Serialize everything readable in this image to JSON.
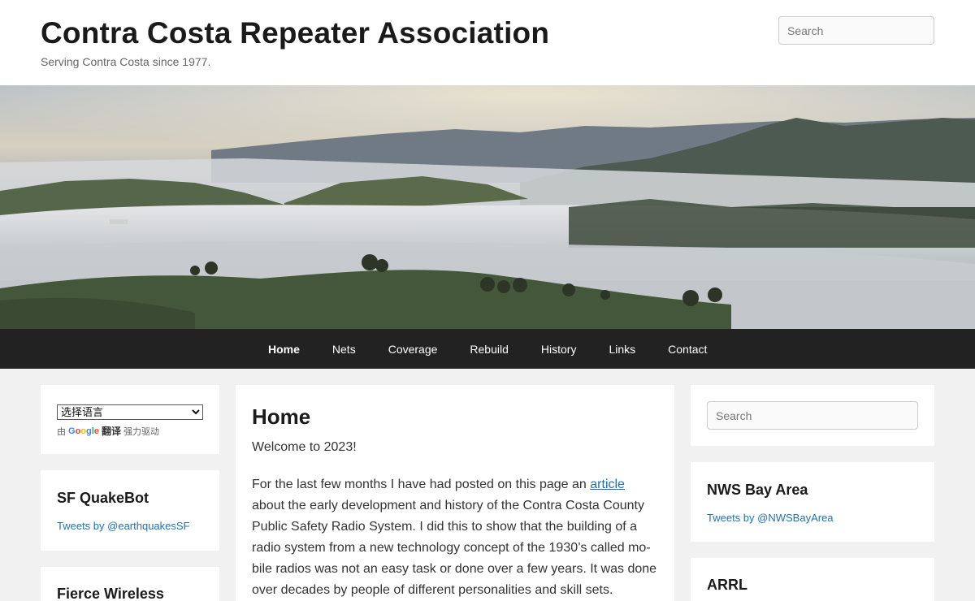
{
  "header": {
    "site_title": "Contra Costa Repeater Association",
    "tagline": "Serving Contra Costa since 1977.",
    "search_placeholder": "Search"
  },
  "nav": {
    "items": [
      {
        "label": "Home",
        "active": true
      },
      {
        "label": "Nets"
      },
      {
        "label": "Coverage"
      },
      {
        "label": "Rebuild"
      },
      {
        "label": "History"
      },
      {
        "label": "Links"
      },
      {
        "label": "Contact"
      }
    ]
  },
  "left_sidebar": {
    "translate": {
      "select_value": "选择语言",
      "powered_prefix": "由",
      "google_word": "Google",
      "translate_word": "翻译",
      "powered_suffix": "强力驱动"
    },
    "quakebot": {
      "title": "SF QuakeBot",
      "link": "Tweets by @earthquakesSF"
    },
    "fierce": {
      "title": "Fierce Wireless"
    }
  },
  "main": {
    "title": "Home",
    "welcome": "Welcome to 2023!",
    "para_before_link": "For the last few months I have had posted on this page an ",
    "link_text": "article",
    "para_after_link": " about the early development and history of the Contra Costa County Public Safety Radio System.  I did this to show that the building of a radio system from a new technology concept of the 1930’s called mo­bile radios was not an easy task or done over a few years.  It was done over decades by people of different personalities and skill sets."
  },
  "right_sidebar": {
    "search_placeholder": "Search",
    "nws": {
      "title": "NWS Bay Area",
      "link": "Tweets by @NWSBayArea"
    },
    "arrl": {
      "title": "ARRL"
    }
  },
  "colors": {
    "nav_bg": "#222222",
    "link": "#2271b1",
    "page_bg": "#f1f1f1"
  }
}
